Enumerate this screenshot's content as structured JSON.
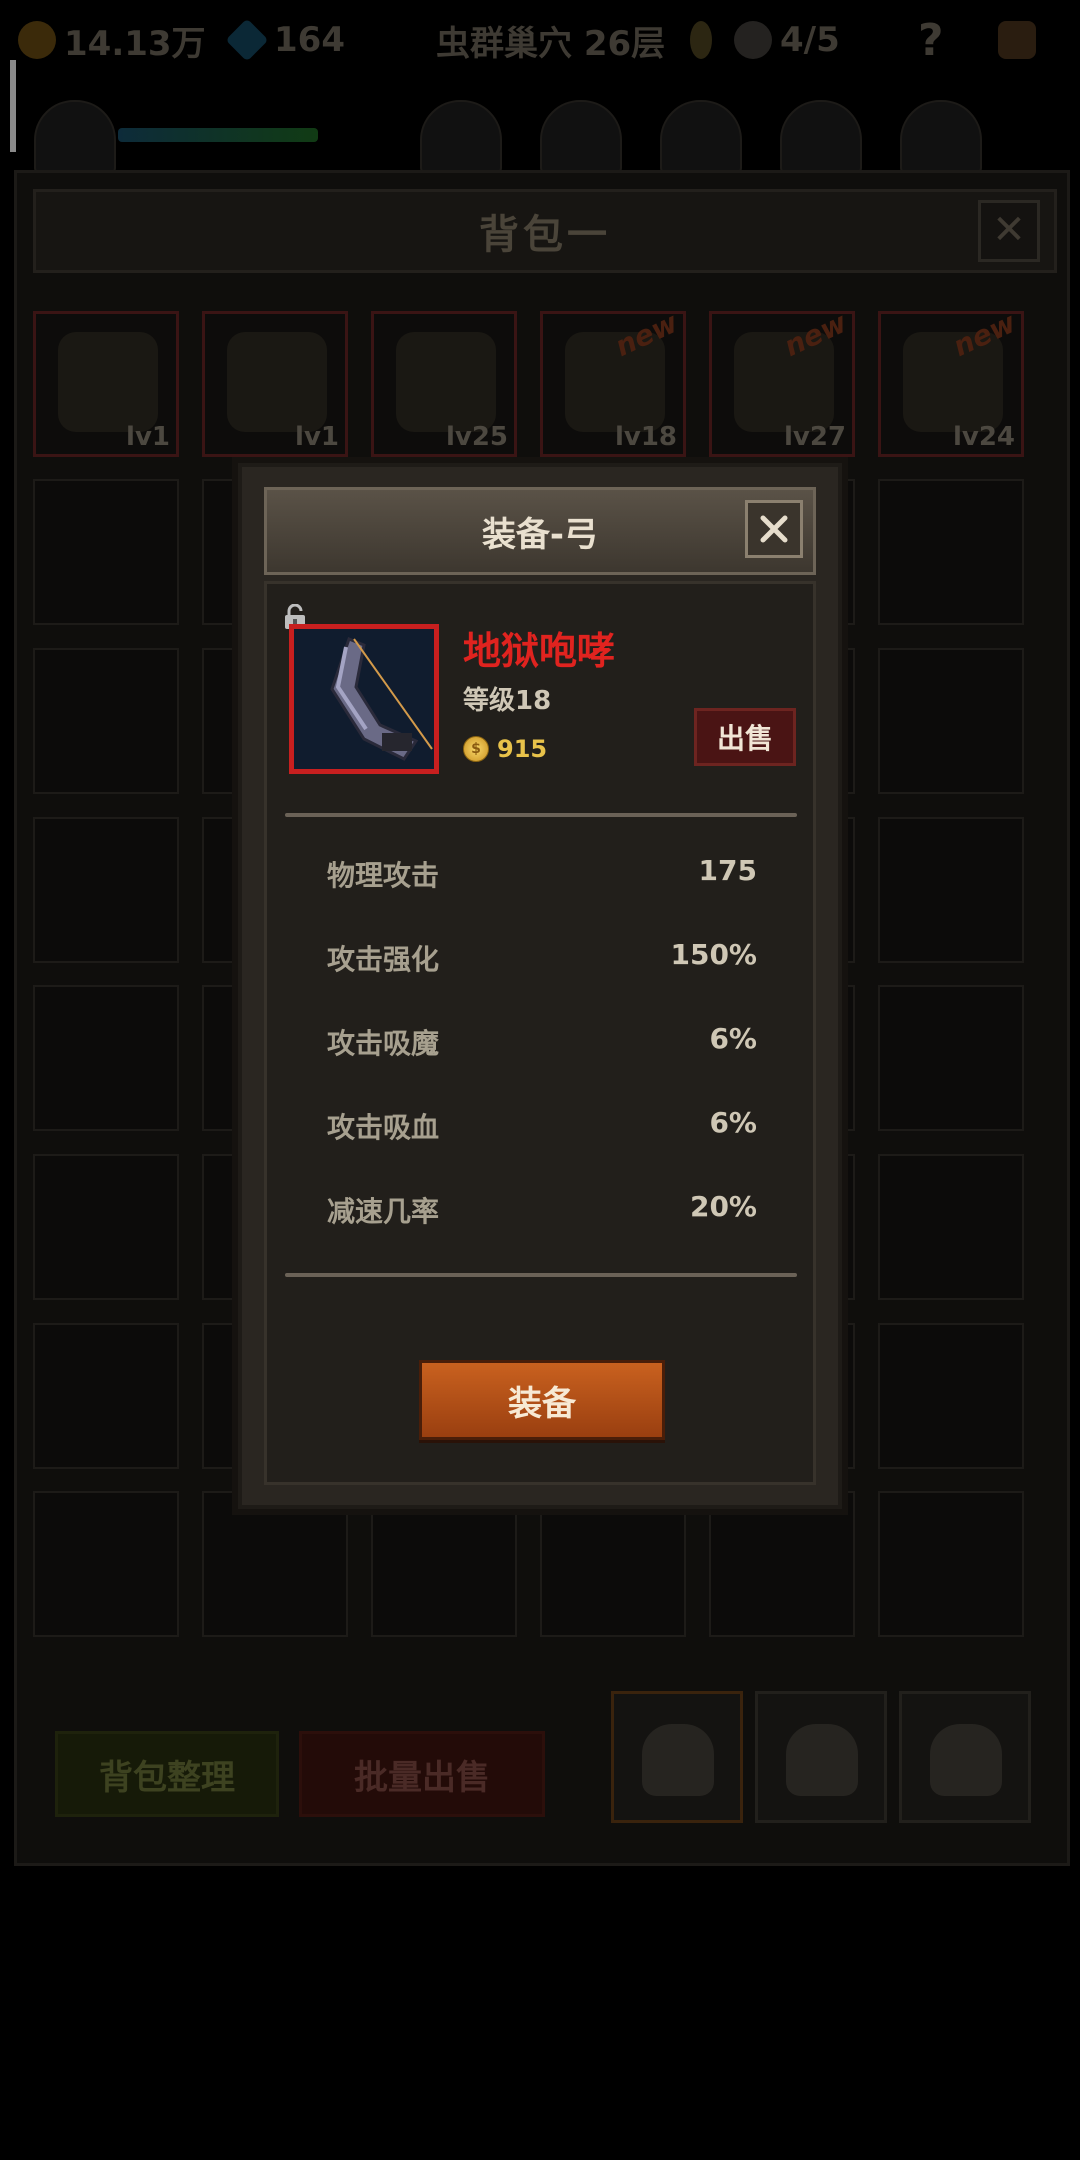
{
  "topbar": {
    "gold": "14.13万",
    "gems": "164",
    "location": "虫群巢穴 26层",
    "keys": "",
    "skulls": "4/5",
    "help": "?"
  },
  "bag": {
    "title": "背包一",
    "close": "✕",
    "top_items": [
      {
        "level": "lv1",
        "new": ""
      },
      {
        "level": "lv1",
        "new": ""
      },
      {
        "level": "lv25",
        "new": ""
      },
      {
        "level": "lv18",
        "new": "new"
      },
      {
        "level": "lv27",
        "new": "new"
      },
      {
        "level": "lv24",
        "new": "new"
      }
    ],
    "sort_button": "背包整理",
    "bulk_sell_button": "批量出售"
  },
  "modal": {
    "title": "装备-弓",
    "item_name": "地狱咆哮",
    "item_level": "等级18",
    "price": "915",
    "sell_button": "出售",
    "stats": [
      {
        "name": "物理攻击",
        "value": "175"
      },
      {
        "name": "攻击强化",
        "value": "150%"
      },
      {
        "name": "攻击吸魔",
        "value": "6%"
      },
      {
        "name": "攻击吸血",
        "value": "6%"
      },
      {
        "name": "减速几率",
        "value": "20%"
      }
    ],
    "equip_button": "装备"
  },
  "colors": {
    "rarity_red": "#c81f1f",
    "equip_orange": "#c9611f",
    "gold_text": "#e8c24a"
  }
}
